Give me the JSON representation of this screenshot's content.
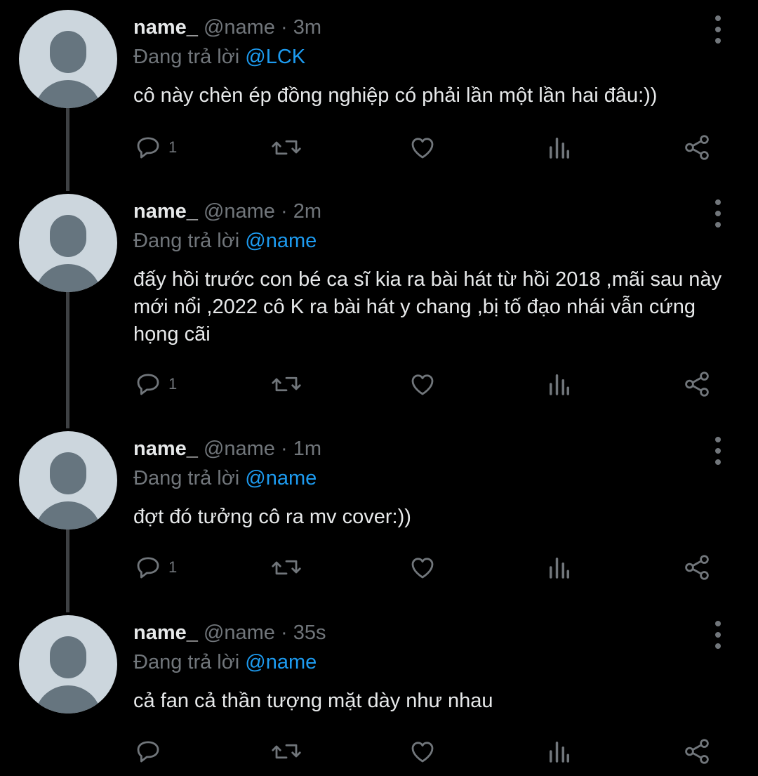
{
  "colors": {
    "background": "#000000",
    "text": "#e7e9ea",
    "muted": "#71767b",
    "mention": "#1d9bf0",
    "avatar_bg": "#ccd6dd"
  },
  "tweets": [
    {
      "name": "name_",
      "handle": "@name",
      "separator": "·",
      "time": "3m",
      "reply_prefix": "Đang trả lời",
      "reply_to": "@LCK",
      "text": "cô này chèn ép đồng nghiệp có phải lần một lần hai đâu:))",
      "reply_count": "1"
    },
    {
      "name": "name_",
      "handle": "@name",
      "separator": "·",
      "time": "2m",
      "reply_prefix": "Đang trả lời",
      "reply_to": "@name",
      "text": "đấy hồi trước con bé ca sĩ kia ra bài hát từ hồi 2018 ,mãi sau này mới nổi ,2022 cô K ra bài hát y chang ,bị tố đạo nhái vẫn cứng họng cãi",
      "reply_count": "1"
    },
    {
      "name": "name_",
      "handle": "@name",
      "separator": "·",
      "time": "1m",
      "reply_prefix": "Đang trả lời",
      "reply_to": "@name",
      "text": "đợt đó tưởng cô ra mv cover:))",
      "reply_count": "1"
    },
    {
      "name": "name_",
      "handle": "@name",
      "separator": "·",
      "time": "35s",
      "reply_prefix": "Đang trả lời",
      "reply_to": "@name",
      "text": "cả fan cả thần tượng mặt dày như nhau",
      "reply_count": ""
    }
  ],
  "icons": [
    "reply-icon",
    "retweet-icon",
    "like-icon",
    "views-icon",
    "share-icon",
    "more-icon"
  ]
}
